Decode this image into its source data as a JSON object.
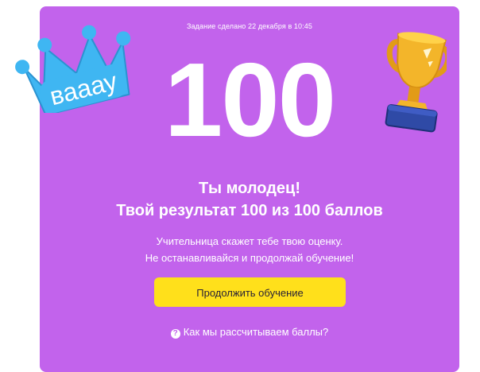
{
  "header": {
    "completed_text": "Задание сделано 22 декабря в 10:45"
  },
  "score": "100",
  "result": {
    "title": "Ты молодец!",
    "summary": "Твой результат 100 из 100 баллов"
  },
  "hint": {
    "line1": "Учительница скажет тебе твою оценку.",
    "line2": "Не останавливайся и продолжай обучение!"
  },
  "continue_button": "Продолжить обучение",
  "help": {
    "icon": "?",
    "text": "Как мы рассчитываем баллы?"
  },
  "sticker": {
    "crown_text": "вааау"
  },
  "colors": {
    "card": "#c263ec",
    "button": "#ffe01b",
    "crown": "#3fb6f2",
    "trophy_gold": "#f3b52a",
    "trophy_base": "#2f4aa6"
  }
}
